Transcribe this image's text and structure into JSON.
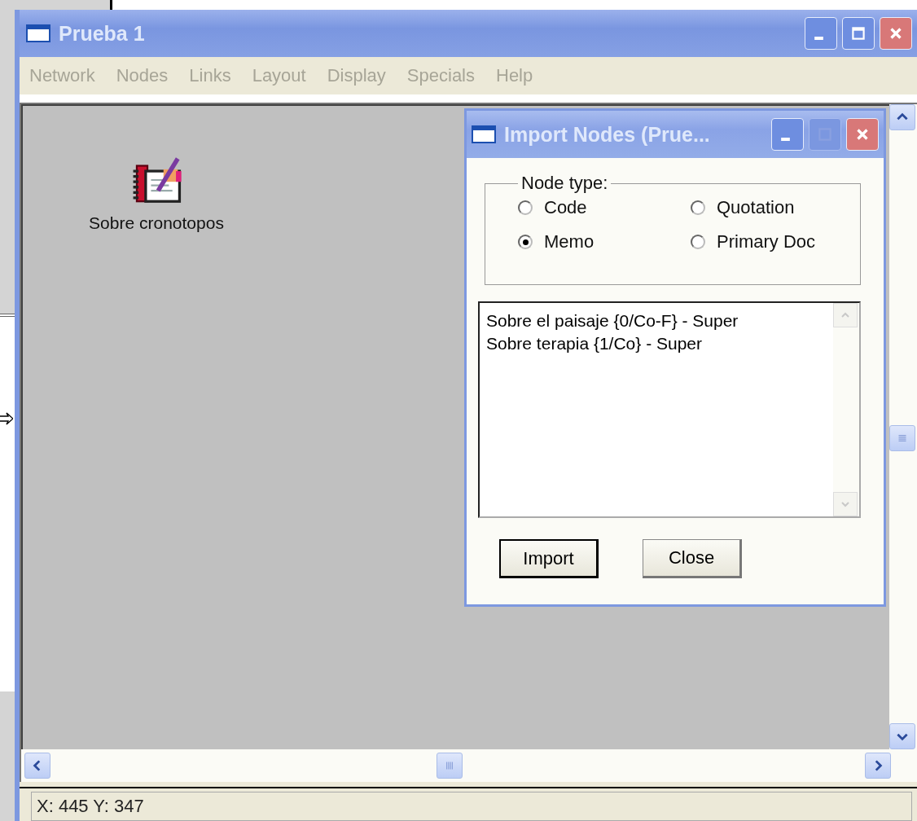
{
  "main_window": {
    "title": "Prueba 1",
    "active": false
  },
  "menu": [
    {
      "label": "Network",
      "disabled": true
    },
    {
      "label": "Nodes",
      "disabled": true
    },
    {
      "label": "Links",
      "disabled": true
    },
    {
      "label": "Layout",
      "disabled": true
    },
    {
      "label": "Display",
      "disabled": true
    },
    {
      "label": "Specials",
      "disabled": true
    },
    {
      "label": "Help",
      "disabled": true
    }
  ],
  "canvas": {
    "nodes": [
      {
        "label": "Sobre cronotopos",
        "kind": "memo"
      }
    ]
  },
  "dialog": {
    "title": "Import Nodes (Prue...",
    "active": true,
    "node_type": {
      "legend": "Node type:",
      "options": [
        {
          "label": "Code",
          "selected": false
        },
        {
          "label": "Quotation",
          "selected": false
        },
        {
          "label": "Memo",
          "selected": true
        },
        {
          "label": "Primary Doc",
          "selected": false
        }
      ]
    },
    "list_items": [
      "Sobre el paisaje {0/Co-F} - Super",
      "Sobre terapia {1/Co} - Super"
    ],
    "buttons": [
      {
        "label": "Import",
        "default": true
      },
      {
        "label": "Close",
        "default": false
      }
    ]
  },
  "status_bar": {
    "text": "X: 445 Y: 347"
  }
}
